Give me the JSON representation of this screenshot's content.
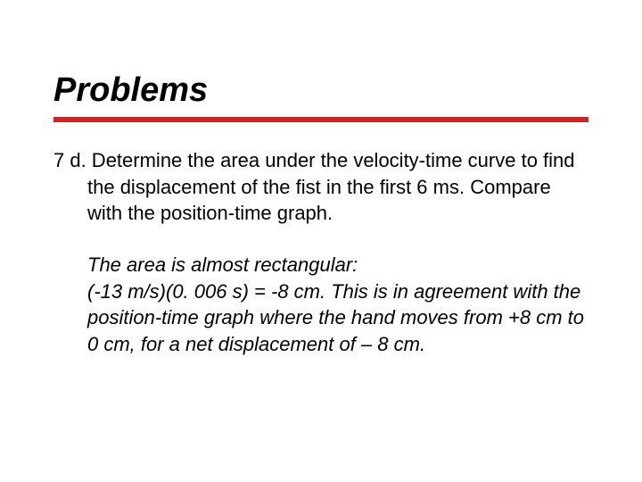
{
  "title": "Problems",
  "question": "7 d. Determine the area under the velocity-time curve to find the displacement of the fist in the first 6 ms.  Compare with the position-time graph.",
  "answer_line1": "The area is almost rectangular:",
  "answer_line2": "(-13 m/s)(0. 006 s) = -8 cm.  This is in agreement with the position-time graph where the hand moves from +8 cm to 0 cm, for a net displacement of – 8 cm."
}
